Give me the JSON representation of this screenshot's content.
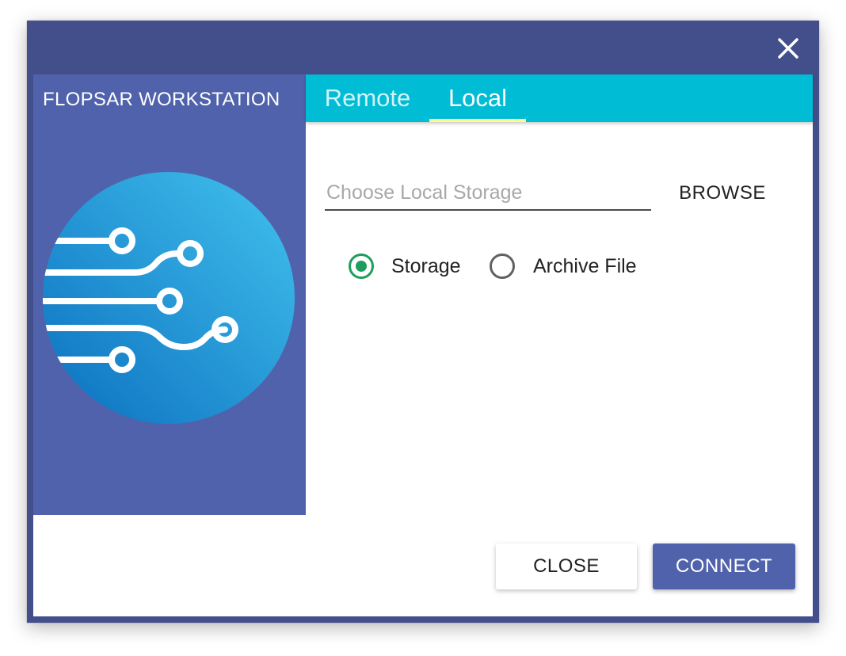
{
  "app": {
    "title": "FLOPSAR WORKSTATION",
    "logo_icon": "circuit-globe-icon"
  },
  "window": {
    "close_icon": "close-icon"
  },
  "tabs": [
    {
      "label": "Remote",
      "active": false
    },
    {
      "label": "Local",
      "active": true
    }
  ],
  "local": {
    "storage_input": {
      "value": "",
      "placeholder": "Choose Local Storage"
    },
    "browse_label": "BROWSE",
    "source_options": [
      {
        "label": "Storage",
        "checked": true
      },
      {
        "label": "Archive File",
        "checked": false
      }
    ]
  },
  "actions": {
    "close_label": "CLOSE",
    "connect_label": "CONNECT"
  },
  "colors": {
    "frame": "#434f8a",
    "brand_panel": "#5062ab",
    "tab_bar": "#00bcd4",
    "tab_indicator": "#ffff8d",
    "radio_checked": "#1e9e5c",
    "primary_button": "#5062ab"
  }
}
